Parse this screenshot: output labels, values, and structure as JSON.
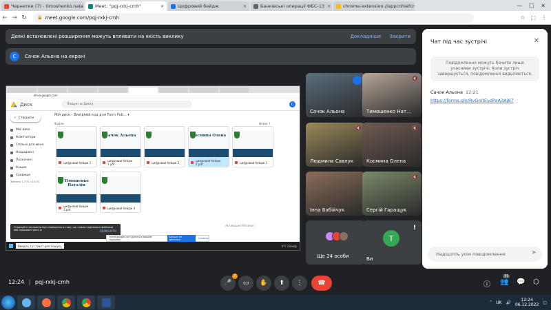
{
  "browser": {
    "tabs": [
      {
        "label": "Чернетки (7) - timoshenko.nata",
        "color": "#ea4335",
        "active": false
      },
      {
        "label": "Meet: \"pqj-rxkj-cmh\"",
        "color": "#00897b",
        "active": true
      },
      {
        "label": "Цифровий бейдж",
        "color": "#1a73e8",
        "active": false
      },
      {
        "label": "Банківські операції ФБС-13",
        "color": "#5f6368",
        "active": false
      },
      {
        "label": "chrome-extension://appcnhiefcnli",
        "color": "#fbbc04",
        "active": false
      }
    ],
    "url": "meet.google.com/pqj-rxkj-cmh"
  },
  "banner": {
    "text": "Деякі встановлені розширення можуть впливати на якість виклику",
    "details_label": "Докладніше",
    "close_label": "Закрити"
  },
  "presenter": {
    "avatar_letter": "С",
    "text": "Сачок Альона на екрані"
  },
  "shared_screen": {
    "drive_title": "Диск",
    "search_placeholder": "Пошук на Диску",
    "create_label": "Створити",
    "sidebar": [
      "Мій диск",
      "Комп'ютери",
      "Спільні для мене",
      "Нещодавні",
      "Позначені",
      "Кошик",
      "Сховище"
    ],
    "storage": "Зайнято 1,7 ГБ з 15 ГБ",
    "breadcrumb": "Мій диск › Вихідний код для Form Pub... ▾",
    "files_header": "Файли",
    "sort_label": "Назва ↑",
    "files": [
      {
        "name": "",
        "caption": "цифровий бейдж 1",
        "selected": false
      },
      {
        "name": "Сачок Альона",
        "caption": "цифровий бейдж 1.pdf",
        "selected": false
      },
      {
        "name": "",
        "caption": "цифровий бейдж 2",
        "selected": false
      },
      {
        "name": "Космина Олена",
        "caption": "цифровий бейдж 2.pdf",
        "selected": true
      },
      {
        "name": "",
        "caption": "цифровий бейдж 3",
        "selected": false
      },
      {
        "name": "Тімошенко Наталія",
        "caption": "цифровий бейдж 3.pdf",
        "selected": false
      },
      {
        "name": "",
        "caption": "цифровий бейдж 4",
        "selected": false
      }
    ],
    "toast_text": "Отримуйте на комп'ютері сповіщення в тому, що з вами поділилися файлами або прокоментують їх",
    "toast_button": "ВВІМКНУТИ",
    "share_text": "meet.google.com ділиться вашим екраном.",
    "share_stop": "Більше не ділитися",
    "share_hide": "Сховати",
    "activate_text": "Активация Windows",
    "taskbar_search": "Введіть тут текст для пошуку",
    "taskbar_weather": "4°C Cloudy"
  },
  "participants": [
    {
      "name": "Сачок Альона",
      "speaking": true,
      "muted": false,
      "bg": "#5b6e7e"
    },
    {
      "name": "Тимошенко Нат...",
      "speaking": false,
      "muted": true,
      "bg": "#b7a79a"
    },
    {
      "name": "Людмила Савлук",
      "speaking": false,
      "muted": true,
      "bg": "#9a8a5a"
    },
    {
      "name": "Космина Олена",
      "speaking": false,
      "muted": true,
      "bg": "#6f5b52"
    },
    {
      "name": "Інна Бабійчук",
      "speaking": false,
      "muted": false,
      "bg": "#8c6e5a"
    },
    {
      "name": "Сергій Гаращук",
      "speaking": false,
      "muted": true,
      "bg": "#7b8a6a"
    }
  ],
  "others_tile": {
    "label": "Ще 24 особи"
  },
  "last_tile": {
    "name": "Ви",
    "avatar_letter": "Т"
  },
  "chat": {
    "title": "Чат під час зустрічі",
    "notice": "Повідомлення можуть бачити лише учасники зустрічі. Коли зустріч завершується, повідомлення видаляються.",
    "messages": [
      {
        "author": "Сачок Альона",
        "time": "12:21",
        "text": "https://forms.gle/RvGnitEydPaA3Aj87"
      }
    ],
    "input_placeholder": "Надішліть усім повідомлення"
  },
  "controls": {
    "meeting_time": "12:24",
    "meeting_code": "pqj-rxkj-cmh",
    "mic_badge": "2",
    "participant_count": "31",
    "chat_badge": "1"
  },
  "taskbar": {
    "lang": "UK",
    "time": "12:24",
    "date": "06.12.2022"
  }
}
